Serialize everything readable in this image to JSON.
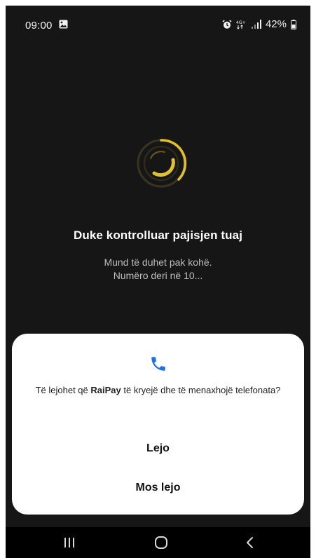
{
  "status_bar": {
    "time": "09:00",
    "network": "4G+",
    "battery": "42%",
    "icons": [
      "image-icon",
      "alarm-icon",
      "network-4g-icon",
      "signal-icon",
      "battery-icon"
    ]
  },
  "loading": {
    "title": "Duke kontrolluar pajisjen tuaj",
    "line1": "Mund të duhet pak kohë.",
    "line2": "Numëro deri në 10...",
    "spinner_color": "#e3c12a"
  },
  "dialog": {
    "icon": "phone-icon",
    "icon_color": "#1a73e8",
    "message_prefix": "Të lejohet që ",
    "app_name": "RaiPay",
    "message_suffix": " të kryejë dhe të menaxhojë telefonata?",
    "allow_label": "Lejo",
    "deny_label": "Mos lejo"
  },
  "nav_bar": {
    "icons": [
      "recents-icon",
      "home-icon",
      "back-icon"
    ]
  }
}
